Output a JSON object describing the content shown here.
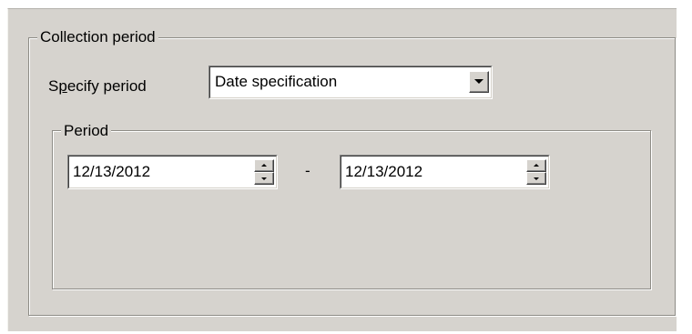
{
  "collection_group": {
    "legend": "Collection period"
  },
  "specify_period": {
    "label_before": "S",
    "label_mnemonic": "p",
    "label_after": "ecify period",
    "selected_value": "Date specification",
    "dropdown_icon": "chevron-down-icon"
  },
  "period_group": {
    "legend": "Period",
    "start_date": "12/13/2012",
    "separator": "-",
    "end_date": "12/13/2012",
    "spinner_icons": [
      "spin-up-icon",
      "spin-down-icon"
    ]
  }
}
